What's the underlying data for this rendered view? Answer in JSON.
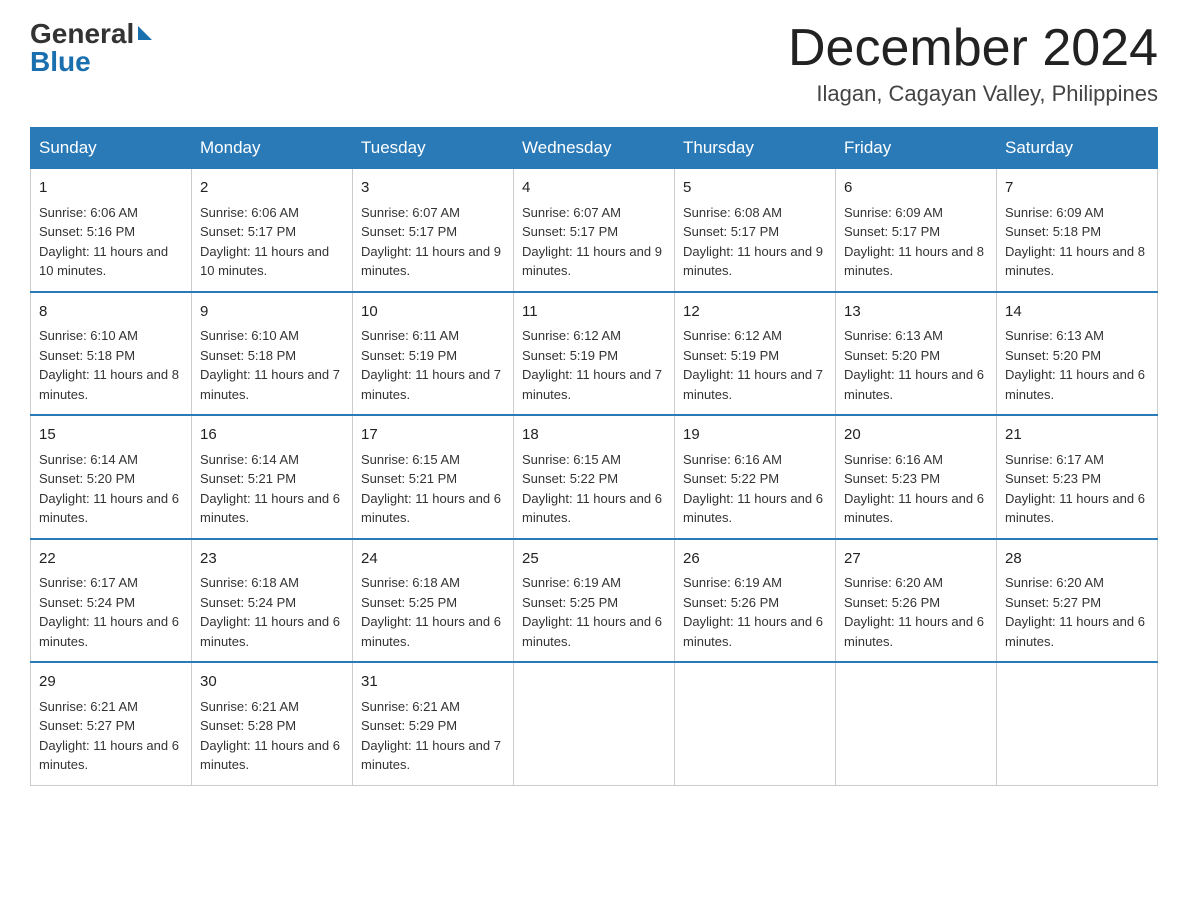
{
  "logo": {
    "general": "General",
    "blue": "Blue"
  },
  "header": {
    "month": "December 2024",
    "location": "Ilagan, Cagayan Valley, Philippines"
  },
  "weekdays": [
    "Sunday",
    "Monday",
    "Tuesday",
    "Wednesday",
    "Thursday",
    "Friday",
    "Saturday"
  ],
  "weeks": [
    [
      {
        "day": "1",
        "sunrise": "6:06 AM",
        "sunset": "5:16 PM",
        "daylight": "11 hours and 10 minutes."
      },
      {
        "day": "2",
        "sunrise": "6:06 AM",
        "sunset": "5:17 PM",
        "daylight": "11 hours and 10 minutes."
      },
      {
        "day": "3",
        "sunrise": "6:07 AM",
        "sunset": "5:17 PM",
        "daylight": "11 hours and 9 minutes."
      },
      {
        "day": "4",
        "sunrise": "6:07 AM",
        "sunset": "5:17 PM",
        "daylight": "11 hours and 9 minutes."
      },
      {
        "day": "5",
        "sunrise": "6:08 AM",
        "sunset": "5:17 PM",
        "daylight": "11 hours and 9 minutes."
      },
      {
        "day": "6",
        "sunrise": "6:09 AM",
        "sunset": "5:17 PM",
        "daylight": "11 hours and 8 minutes."
      },
      {
        "day": "7",
        "sunrise": "6:09 AM",
        "sunset": "5:18 PM",
        "daylight": "11 hours and 8 minutes."
      }
    ],
    [
      {
        "day": "8",
        "sunrise": "6:10 AM",
        "sunset": "5:18 PM",
        "daylight": "11 hours and 8 minutes."
      },
      {
        "day": "9",
        "sunrise": "6:10 AM",
        "sunset": "5:18 PM",
        "daylight": "11 hours and 7 minutes."
      },
      {
        "day": "10",
        "sunrise": "6:11 AM",
        "sunset": "5:19 PM",
        "daylight": "11 hours and 7 minutes."
      },
      {
        "day": "11",
        "sunrise": "6:12 AM",
        "sunset": "5:19 PM",
        "daylight": "11 hours and 7 minutes."
      },
      {
        "day": "12",
        "sunrise": "6:12 AM",
        "sunset": "5:19 PM",
        "daylight": "11 hours and 7 minutes."
      },
      {
        "day": "13",
        "sunrise": "6:13 AM",
        "sunset": "5:20 PM",
        "daylight": "11 hours and 6 minutes."
      },
      {
        "day": "14",
        "sunrise": "6:13 AM",
        "sunset": "5:20 PM",
        "daylight": "11 hours and 6 minutes."
      }
    ],
    [
      {
        "day": "15",
        "sunrise": "6:14 AM",
        "sunset": "5:20 PM",
        "daylight": "11 hours and 6 minutes."
      },
      {
        "day": "16",
        "sunrise": "6:14 AM",
        "sunset": "5:21 PM",
        "daylight": "11 hours and 6 minutes."
      },
      {
        "day": "17",
        "sunrise": "6:15 AM",
        "sunset": "5:21 PM",
        "daylight": "11 hours and 6 minutes."
      },
      {
        "day": "18",
        "sunrise": "6:15 AM",
        "sunset": "5:22 PM",
        "daylight": "11 hours and 6 minutes."
      },
      {
        "day": "19",
        "sunrise": "6:16 AM",
        "sunset": "5:22 PM",
        "daylight": "11 hours and 6 minutes."
      },
      {
        "day": "20",
        "sunrise": "6:16 AM",
        "sunset": "5:23 PM",
        "daylight": "11 hours and 6 minutes."
      },
      {
        "day": "21",
        "sunrise": "6:17 AM",
        "sunset": "5:23 PM",
        "daylight": "11 hours and 6 minutes."
      }
    ],
    [
      {
        "day": "22",
        "sunrise": "6:17 AM",
        "sunset": "5:24 PM",
        "daylight": "11 hours and 6 minutes."
      },
      {
        "day": "23",
        "sunrise": "6:18 AM",
        "sunset": "5:24 PM",
        "daylight": "11 hours and 6 minutes."
      },
      {
        "day": "24",
        "sunrise": "6:18 AM",
        "sunset": "5:25 PM",
        "daylight": "11 hours and 6 minutes."
      },
      {
        "day": "25",
        "sunrise": "6:19 AM",
        "sunset": "5:25 PM",
        "daylight": "11 hours and 6 minutes."
      },
      {
        "day": "26",
        "sunrise": "6:19 AM",
        "sunset": "5:26 PM",
        "daylight": "11 hours and 6 minutes."
      },
      {
        "day": "27",
        "sunrise": "6:20 AM",
        "sunset": "5:26 PM",
        "daylight": "11 hours and 6 minutes."
      },
      {
        "day": "28",
        "sunrise": "6:20 AM",
        "sunset": "5:27 PM",
        "daylight": "11 hours and 6 minutes."
      }
    ],
    [
      {
        "day": "29",
        "sunrise": "6:21 AM",
        "sunset": "5:27 PM",
        "daylight": "11 hours and 6 minutes."
      },
      {
        "day": "30",
        "sunrise": "6:21 AM",
        "sunset": "5:28 PM",
        "daylight": "11 hours and 6 minutes."
      },
      {
        "day": "31",
        "sunrise": "6:21 AM",
        "sunset": "5:29 PM",
        "daylight": "11 hours and 7 minutes."
      },
      null,
      null,
      null,
      null
    ]
  ]
}
